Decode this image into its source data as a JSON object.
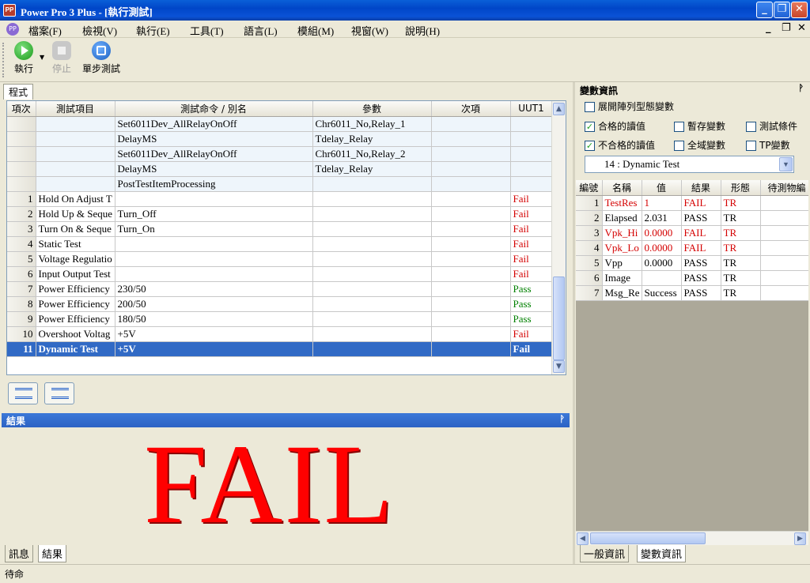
{
  "window": {
    "title": "Power Pro 3 Plus - [執行測試]",
    "app_icon_text": "PP"
  },
  "menu": [
    "檔案(F)",
    "檢視(V)",
    "執行(E)",
    "工具(T)",
    "語言(L)",
    "模組(M)",
    "視窗(W)",
    "說明(H)"
  ],
  "toolbar": {
    "run": "執行",
    "stop": "停止",
    "step": "單步測試"
  },
  "program_panel": {
    "tab": "程式",
    "columns": [
      "項次",
      "測試項目",
      "測試命令 / 別名",
      "參數",
      "次項",
      "UUT1"
    ],
    "rows": [
      {
        "idx": "",
        "item": "",
        "cmd": "Set6011Dev_AllRelayOnOff",
        "param": "Chr6011_No,Relay_1",
        "sub": "",
        "uut": "",
        "status": "",
        "kind": "sub"
      },
      {
        "idx": "",
        "item": "",
        "cmd": "DelayMS",
        "param": "Tdelay_Relay",
        "sub": "",
        "uut": "",
        "status": "",
        "kind": "sub"
      },
      {
        "idx": "",
        "item": "",
        "cmd": "Set6011Dev_AllRelayOnOff",
        "param": "Chr6011_No,Relay_2",
        "sub": "",
        "uut": "",
        "status": "",
        "kind": "sub"
      },
      {
        "idx": "",
        "item": "",
        "cmd": "DelayMS",
        "param": "Tdelay_Relay",
        "sub": "",
        "uut": "",
        "status": "",
        "kind": "sub"
      },
      {
        "idx": "",
        "item": "",
        "cmd": "PostTestItemProcessing",
        "param": "",
        "sub": "",
        "uut": "",
        "status": "",
        "kind": "sub"
      },
      {
        "idx": "1",
        "item": "Hold On Adjust T",
        "cmd": "",
        "param": "",
        "sub": "",
        "uut": "Fail",
        "status": "fail",
        "kind": "main"
      },
      {
        "idx": "2",
        "item": "Hold Up & Seque",
        "cmd": "Turn_Off",
        "param": "",
        "sub": "",
        "uut": "Fail",
        "status": "fail",
        "kind": "main"
      },
      {
        "idx": "3",
        "item": "Turn On & Seque",
        "cmd": "Turn_On",
        "param": "",
        "sub": "",
        "uut": "Fail",
        "status": "fail",
        "kind": "main"
      },
      {
        "idx": "4",
        "item": "Static Test",
        "cmd": "",
        "param": "",
        "sub": "",
        "uut": "Fail",
        "status": "fail",
        "kind": "main"
      },
      {
        "idx": "5",
        "item": "Voltage Regulatio",
        "cmd": "",
        "param": "",
        "sub": "",
        "uut": "Fail",
        "status": "fail",
        "kind": "main"
      },
      {
        "idx": "6",
        "item": "Input Output Test",
        "cmd": "",
        "param": "",
        "sub": "",
        "uut": "Fail",
        "status": "fail",
        "kind": "main"
      },
      {
        "idx": "7",
        "item": "Power Efficiency",
        "cmd": "230/50",
        "param": "",
        "sub": "",
        "uut": "Pass",
        "status": "pass",
        "kind": "main"
      },
      {
        "idx": "8",
        "item": "Power Efficiency",
        "cmd": "200/50",
        "param": "",
        "sub": "",
        "uut": "Pass",
        "status": "pass",
        "kind": "main"
      },
      {
        "idx": "9",
        "item": "Power Efficiency",
        "cmd": "180/50",
        "param": "",
        "sub": "",
        "uut": "Pass",
        "status": "pass",
        "kind": "main"
      },
      {
        "idx": "10",
        "item": "Overshoot Voltag",
        "cmd": "+5V",
        "param": "",
        "sub": "",
        "uut": "Fail",
        "status": "fail",
        "kind": "main"
      },
      {
        "idx": "11",
        "item": "Dynamic Test",
        "cmd": "+5V",
        "param": "",
        "sub": "",
        "uut": "Fail",
        "status": "fail",
        "kind": "sel"
      }
    ]
  },
  "result_panel": {
    "title": "結果",
    "big_text": "FAIL",
    "tabs": [
      "訊息",
      "結果"
    ]
  },
  "var_panel": {
    "title": "變數資訊",
    "expand_array": "展開陣列型態變數",
    "checks": [
      {
        "label": "合格的讀值",
        "checked": true
      },
      {
        "label": "暫存變數",
        "checked": false
      },
      {
        "label": "測試條件",
        "checked": false
      },
      {
        "label": "不合格的讀值",
        "checked": true
      },
      {
        "label": "全域變數",
        "checked": false
      },
      {
        "label": "TP變數",
        "checked": false
      }
    ],
    "dropdown": "14 : Dynamic Test",
    "columns": [
      "編號",
      "名稱",
      "值",
      "結果",
      "形態",
      "待測物編"
    ],
    "rows": [
      {
        "no": "1",
        "name": "TestRes",
        "value": "1",
        "result": "FAIL",
        "type": "TR",
        "red": true
      },
      {
        "no": "2",
        "name": "Elapsed",
        "value": "2.031",
        "result": "PASS",
        "type": "TR",
        "red": false
      },
      {
        "no": "3",
        "name": "Vpk_Hi",
        "value": "0.0000",
        "result": "FAIL",
        "type": "TR",
        "red": true
      },
      {
        "no": "4",
        "name": "Vpk_Lo",
        "value": "0.0000",
        "result": "FAIL",
        "type": "TR",
        "red": true
      },
      {
        "no": "5",
        "name": "Vpp",
        "value": "0.0000",
        "result": "PASS",
        "type": "TR",
        "red": false
      },
      {
        "no": "6",
        "name": "Image",
        "value": "",
        "result": "PASS",
        "type": "TR",
        "red": false
      },
      {
        "no": "7",
        "name": "Msg_Re",
        "value": "Success",
        "result": "PASS",
        "type": "TR",
        "red": false
      }
    ],
    "tabs": [
      "一般資訊",
      "變數資訊"
    ]
  },
  "status": "待命",
  "colors": {
    "fail": "#d40000",
    "pass": "#008000",
    "selection": "#316ac5",
    "title_bar": "#0a52d6"
  }
}
